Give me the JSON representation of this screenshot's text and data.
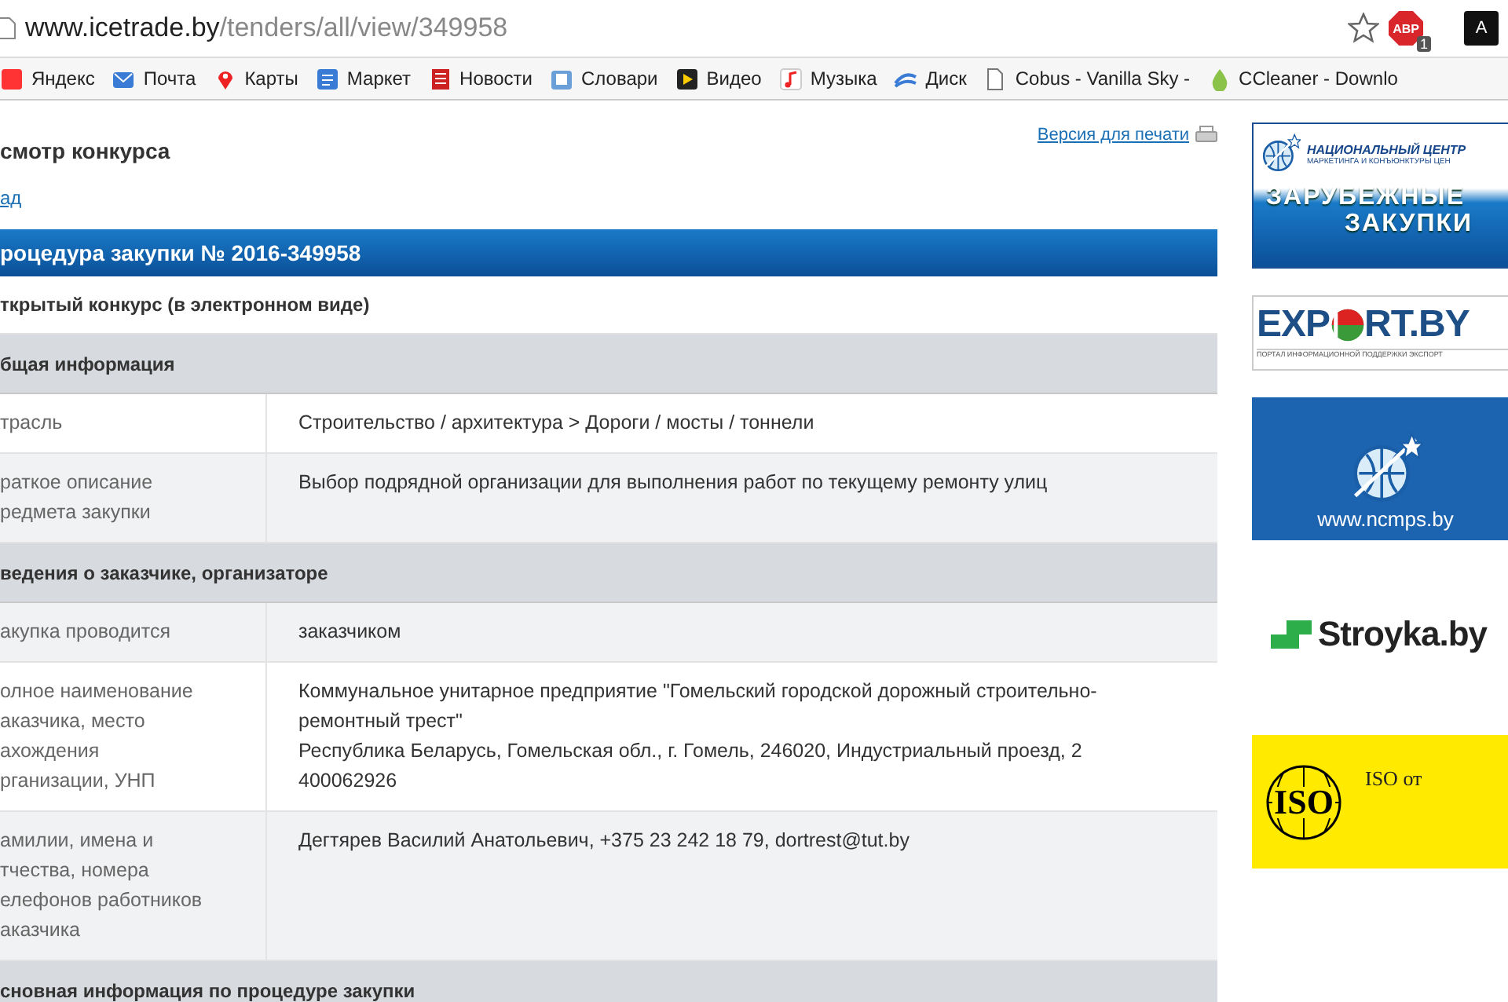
{
  "browser": {
    "url_host": "www.icetrade.by",
    "url_path": "/tenders/all/view/349958",
    "extensions": [
      {
        "kind": "abp",
        "label": "ABP",
        "badge": "1"
      },
      {
        "kind": "plain",
        "label": "A"
      }
    ]
  },
  "bookmarks": [
    {
      "kind": "search",
      "label": "Яндекс"
    },
    {
      "kind": "mail",
      "label": "Почта"
    },
    {
      "kind": "pin",
      "label": "Карты"
    },
    {
      "kind": "market",
      "label": "Маркет"
    },
    {
      "kind": "news",
      "label": "Новости"
    },
    {
      "kind": "book",
      "label": "Словари"
    },
    {
      "kind": "video",
      "label": "Видео"
    },
    {
      "kind": "music",
      "label": "Музыка"
    },
    {
      "kind": "disk",
      "label": "Диск"
    },
    {
      "kind": "page",
      "label": "Cobus - Vanilla Sky - "
    },
    {
      "kind": "drop",
      "label": "CCleaner - Downlo"
    }
  ],
  "page": {
    "title": "смотр конкурса",
    "back_link": "ад",
    "print_link": "Версия для печати",
    "procedure_header": "роцедура закупки № 2016-349958",
    "procedure_type": "ткрытый конкурс (в электронном виде)",
    "rows": [
      {
        "kind": "section",
        "label": [
          "бщая информация"
        ]
      },
      {
        "kind": "field",
        "label": [
          "трасль"
        ],
        "value": [
          "Строительство / архитектура > Дороги / мосты / тоннели"
        ]
      },
      {
        "kind": "field",
        "label": [
          "раткое описание",
          "редмета закупки"
        ],
        "value": [
          "Выбор подрядной организации для выполнения работ по текущему ремонту улиц"
        ]
      },
      {
        "kind": "section",
        "label": [
          "ведения о заказчике, организаторе"
        ]
      },
      {
        "kind": "field",
        "label": [
          "акупка проводится"
        ],
        "value": [
          "заказчиком"
        ]
      },
      {
        "kind": "field",
        "label": [
          "олное наименование",
          "аказчика, место",
          "ахождения",
          "рганизации, УНП"
        ],
        "value": [
          "Коммунальное унитарное предприятие \"Гомельский городской дорожный строительно-",
          "ремонтный трест\"",
          "Республика Беларусь, Гомельская обл., г. Гомель, 246020, Индустриальный проезд, 2",
          "400062926"
        ]
      },
      {
        "kind": "field",
        "label": [
          "амилии, имена и",
          "тчества, номера",
          "елефонов работников",
          "аказчика"
        ],
        "value": [
          "Дегтярев Василий Анатольевич, +375 23 242 18 79, dortrest@tut.by"
        ]
      },
      {
        "kind": "section",
        "label": [
          "сновная информация по процедуре закупки"
        ]
      }
    ]
  },
  "ads": [
    {
      "kind": "ncmc",
      "texts": [
        "НАЦИОНАЛЬНЫЙ ЦЕНТР",
        "МАРКЕТИНГА И КОНЪЮНКТУРЫ ЦЕН",
        "ЗАРУБЕЖНЫЕ",
        "ЗАКУПКИ"
      ]
    },
    {
      "kind": "export",
      "texts": [
        "EXP",
        "RT.BY",
        "ПОРТАЛ ИНФОРМАЦИОННОЙ ПОДДЕРЖКИ ЭКСПОРТ"
      ]
    },
    {
      "kind": "ncmps",
      "texts": [
        "www.ncmps.by"
      ]
    },
    {
      "kind": "stroyka",
      "texts": [
        "Stroyka.by"
      ]
    },
    {
      "kind": "iso",
      "texts": [
        "ISO",
        "ISO от"
      ]
    }
  ]
}
